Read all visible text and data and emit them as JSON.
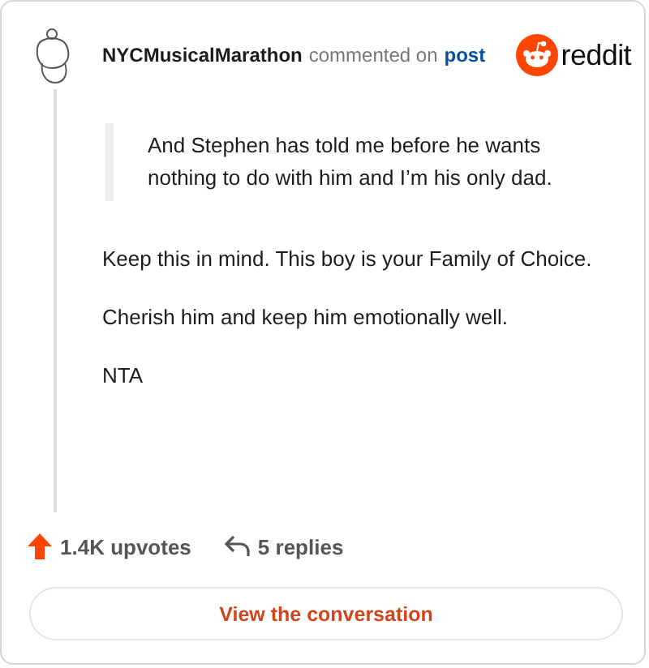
{
  "header": {
    "username": "NYCMusicalMarathon",
    "action": "commented on",
    "link": "post",
    "brand": "reddit"
  },
  "quote": "And Stephen has told me before he wants nothing to do with him and I’m his only dad.",
  "paragraphs": [
    "Keep this in mind. This boy is your Family of Choice.",
    "Cherish him and keep him emotionally well.",
    "NTA"
  ],
  "upvotes": "1.4K upvotes",
  "replies": "5 replies",
  "button": "View the conversation"
}
